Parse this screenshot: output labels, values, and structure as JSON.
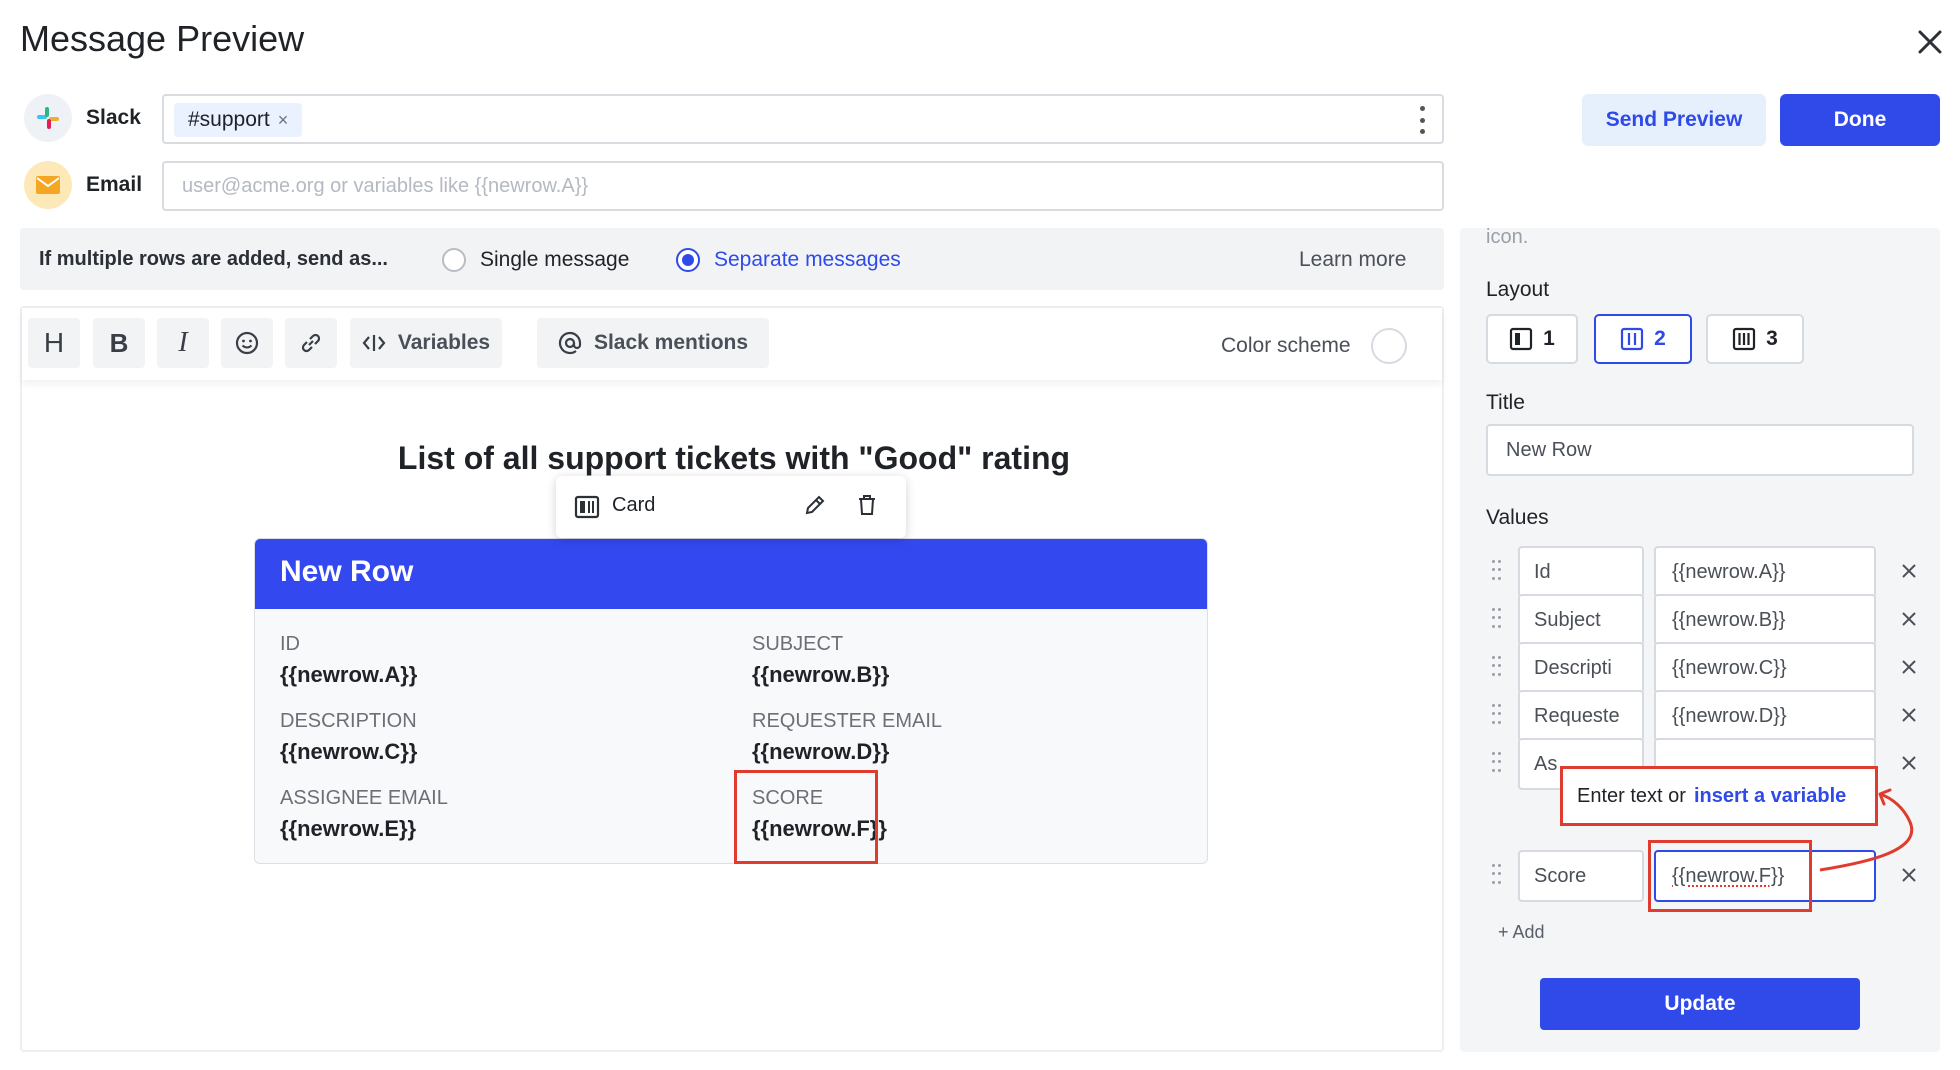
{
  "dialog": {
    "title": "Message Preview"
  },
  "recipients": {
    "slack_label": "Slack",
    "slack_chip": "#support",
    "slack_chip_remove": "×",
    "email_label": "Email",
    "email_placeholder": "user@acme.org or variables like {{newrow.A}}"
  },
  "actions": {
    "send_preview": "Send Preview",
    "done": "Done"
  },
  "multi_row": {
    "prompt": "If multiple rows are added, send as...",
    "option_single": "Single message",
    "option_separate": "Separate messages",
    "selected": "Separate messages",
    "learn_more": "Learn more"
  },
  "toolbar": {
    "heading": "H",
    "bold": "B",
    "italic": "I",
    "variables": "Variables",
    "slack_mentions": "Slack mentions",
    "color_scheme": "Color scheme"
  },
  "message": {
    "title": "List of all support tickets with \"Good\" rating",
    "popover_label": "Card",
    "card": {
      "header": "New Row",
      "fields": [
        {
          "label": "ID",
          "value": "{{newrow.A}}"
        },
        {
          "label": "SUBJECT",
          "value": "{{newrow.B}}"
        },
        {
          "label": "DESCRIPTION",
          "value": "{{newrow.C}}"
        },
        {
          "label": "REQUESTER EMAIL",
          "value": "{{newrow.D}}"
        },
        {
          "label": "ASSIGNEE EMAIL",
          "value": "{{newrow.E}}"
        },
        {
          "label": "SCORE",
          "value": "{{newrow.F}}"
        }
      ]
    }
  },
  "side_panel": {
    "cut_text": "icon.",
    "layout_heading": "Layout",
    "layout_options": [
      "1",
      "2",
      "3"
    ],
    "layout_selected": "2",
    "title_heading": "Title",
    "title_value": "New Row",
    "values_heading": "Values",
    "values": [
      {
        "key": "Id",
        "value": "{{newrow.A}}"
      },
      {
        "key": "Subject",
        "value": "{{newrow.B}}"
      },
      {
        "key": "Descripti",
        "value": "{{newrow.C}}"
      },
      {
        "key": "Requeste",
        "value": "{{newrow.D}}"
      },
      {
        "key": "As",
        "value": ""
      },
      {
        "key": "Score",
        "value": "{{newrow.F}}"
      }
    ],
    "add_label": "+ Add",
    "update_label": "Update"
  },
  "tooltip": {
    "text": "Enter text or",
    "link": "insert a variable"
  },
  "colors": {
    "accent": "#2f4ae8",
    "card_header": "#3448f0",
    "annotation": "#e03b2f"
  }
}
